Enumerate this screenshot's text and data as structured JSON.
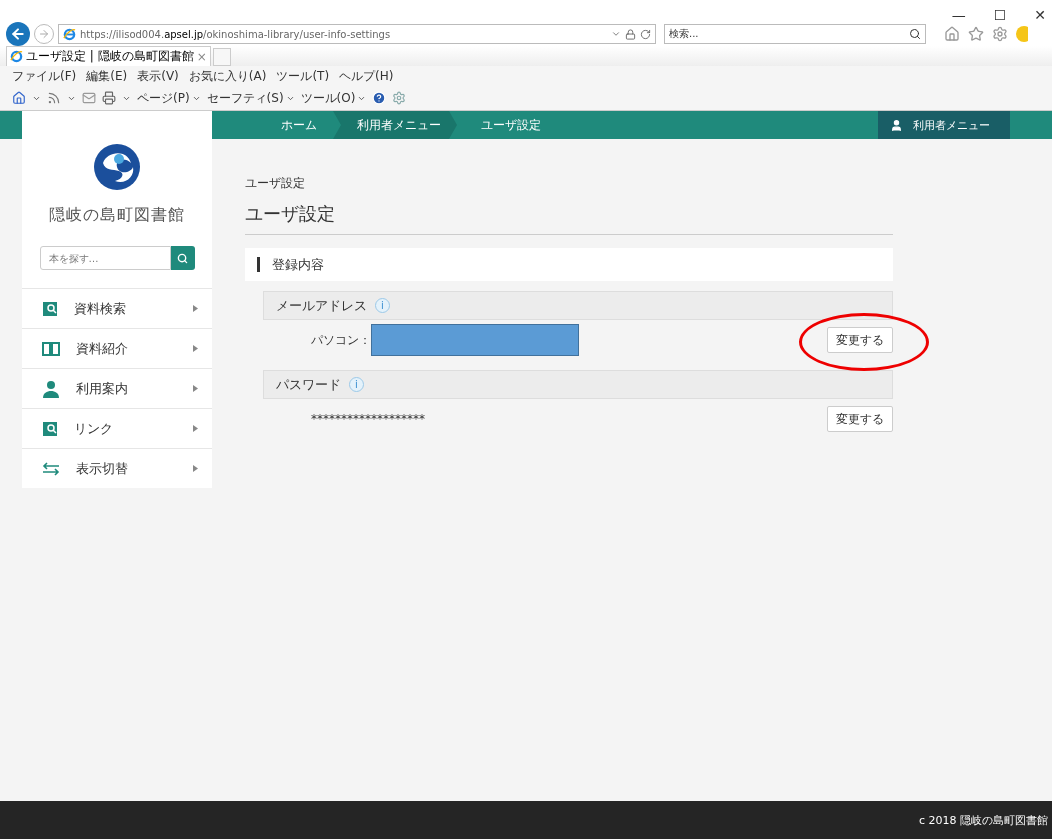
{
  "browser": {
    "window_controls": [
      "—",
      "☐",
      "✕"
    ],
    "url": "https://ilisod004.**apsel.jp**/okinoshima-library/user-info-settings",
    "search_placeholder": "検索...",
    "tab_title": "ユーザ設定 | 隠岐の島町図書館",
    "tab_close": "×",
    "menu": [
      "ファイル(F)",
      "編集(E)",
      "表示(V)",
      "お気に入り(A)",
      "ツール(T)",
      "ヘルプ(H)"
    ],
    "commands": [
      "ページ(P)",
      "セーフティ(S)",
      "ツール(O)"
    ]
  },
  "site": {
    "breadcrumbs": [
      "ホーム",
      "利用者メニュー",
      "ユーザ設定"
    ],
    "user_menu": "利用者メニュー",
    "library_name": "隠岐の島町図書館",
    "search_placeholder": "本を探す…",
    "nav": [
      {
        "label": "資料検索",
        "kind": "search"
      },
      {
        "label": "資料紹介",
        "kind": "book"
      },
      {
        "label": "利用案内",
        "kind": "person"
      },
      {
        "label": "リンク",
        "kind": "search"
      },
      {
        "label": "表示切替",
        "kind": "arrows"
      }
    ],
    "page_breadcrumb": "ユーザ設定",
    "title": "ユーザ設定",
    "section": "登録内容",
    "fields": [
      {
        "label": "メールアドレス",
        "info": "i",
        "value_label": "パソコン：",
        "redacted": true,
        "button": "変更する",
        "circled": true
      },
      {
        "label": "パスワード",
        "info": "i",
        "value": "*******************",
        "redacted": false,
        "button": "変更する",
        "circled": false
      }
    ],
    "footer": "c 2018 隠岐の島町図書館"
  }
}
